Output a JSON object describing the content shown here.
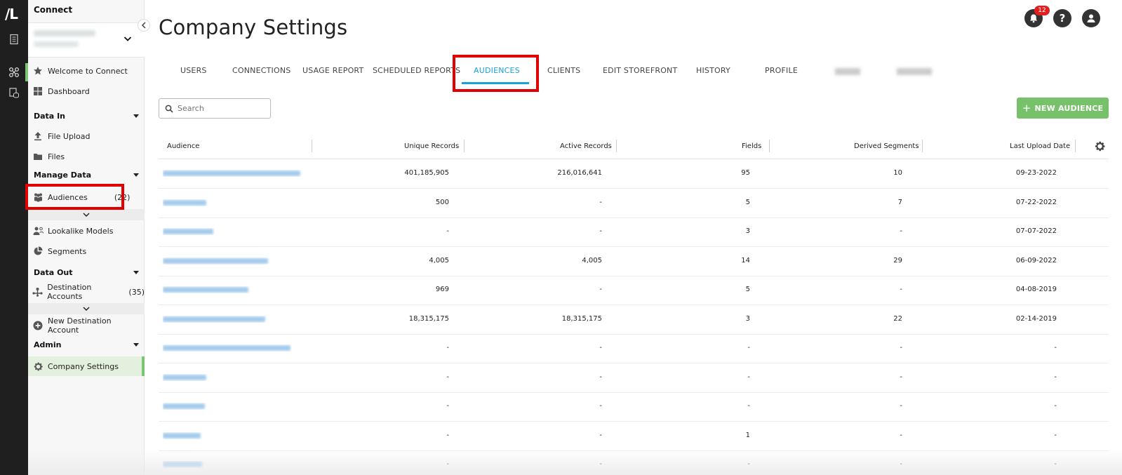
{
  "app": {
    "logo": "/L",
    "name": "Connect"
  },
  "sidebar": {
    "welcome": "Welcome to Connect",
    "dashboard": "Dashboard",
    "data_in": "Data In",
    "file_upload": "File Upload",
    "files": "Files",
    "manage_data": "Manage Data",
    "audiences": "Audiences",
    "audiences_count": "(22)",
    "lookalike": "Lookalike Models",
    "segments": "Segments",
    "data_out": "Data Out",
    "destination_accounts": "Destination Accounts",
    "destination_count": "(35)",
    "new_destination": "New Destination Account",
    "admin": "Admin",
    "company_settings": "Company Settings"
  },
  "header": {
    "title": "Company Settings",
    "notifications": "12"
  },
  "tabs": [
    "USERS",
    "CONNECTIONS",
    "USAGE REPORT",
    "SCHEDULED REPORTS",
    "AUDIENCES",
    "CLIENTS",
    "EDIT STOREFRONT",
    "HISTORY",
    "PROFILE"
  ],
  "search": {
    "placeholder": "Search"
  },
  "new_button": "NEW AUDIENCE",
  "table": {
    "columns": [
      "Audience",
      "Unique Records",
      "Active Records",
      "Fields",
      "Derived Segments",
      "Last Upload Date"
    ],
    "rows": [
      {
        "unique": "401,185,905",
        "active": "216,016,641",
        "fields": "95",
        "derived": "10",
        "date": "09-23-2022"
      },
      {
        "unique": "500",
        "active": "-",
        "fields": "5",
        "derived": "7",
        "date": "07-22-2022"
      },
      {
        "unique": "-",
        "active": "-",
        "fields": "3",
        "derived": "-",
        "date": "07-07-2022"
      },
      {
        "unique": "4,005",
        "active": "4,005",
        "fields": "14",
        "derived": "29",
        "date": "06-09-2022"
      },
      {
        "unique": "969",
        "active": "-",
        "fields": "5",
        "derived": "-",
        "date": "04-08-2019"
      },
      {
        "unique": "18,315,175",
        "active": "18,315,175",
        "fields": "3",
        "derived": "22",
        "date": "02-14-2019"
      },
      {
        "unique": "-",
        "active": "-",
        "fields": "-",
        "derived": "-",
        "date": "-"
      },
      {
        "unique": "-",
        "active": "-",
        "fields": "-",
        "derived": "-",
        "date": "-"
      },
      {
        "unique": "-",
        "active": "-",
        "fields": "-",
        "derived": "-",
        "date": "-"
      },
      {
        "unique": "-",
        "active": "-",
        "fields": "1",
        "derived": "-",
        "date": "-"
      },
      {
        "unique": "-",
        "active": "-",
        "fields": "-",
        "derived": "-",
        "date": "-"
      }
    ]
  },
  "colors": {
    "accent_green": "#76c169",
    "tab_blue": "#1aa3d6",
    "highlight_red": "#e00000",
    "rail": "#1f1f1f"
  }
}
